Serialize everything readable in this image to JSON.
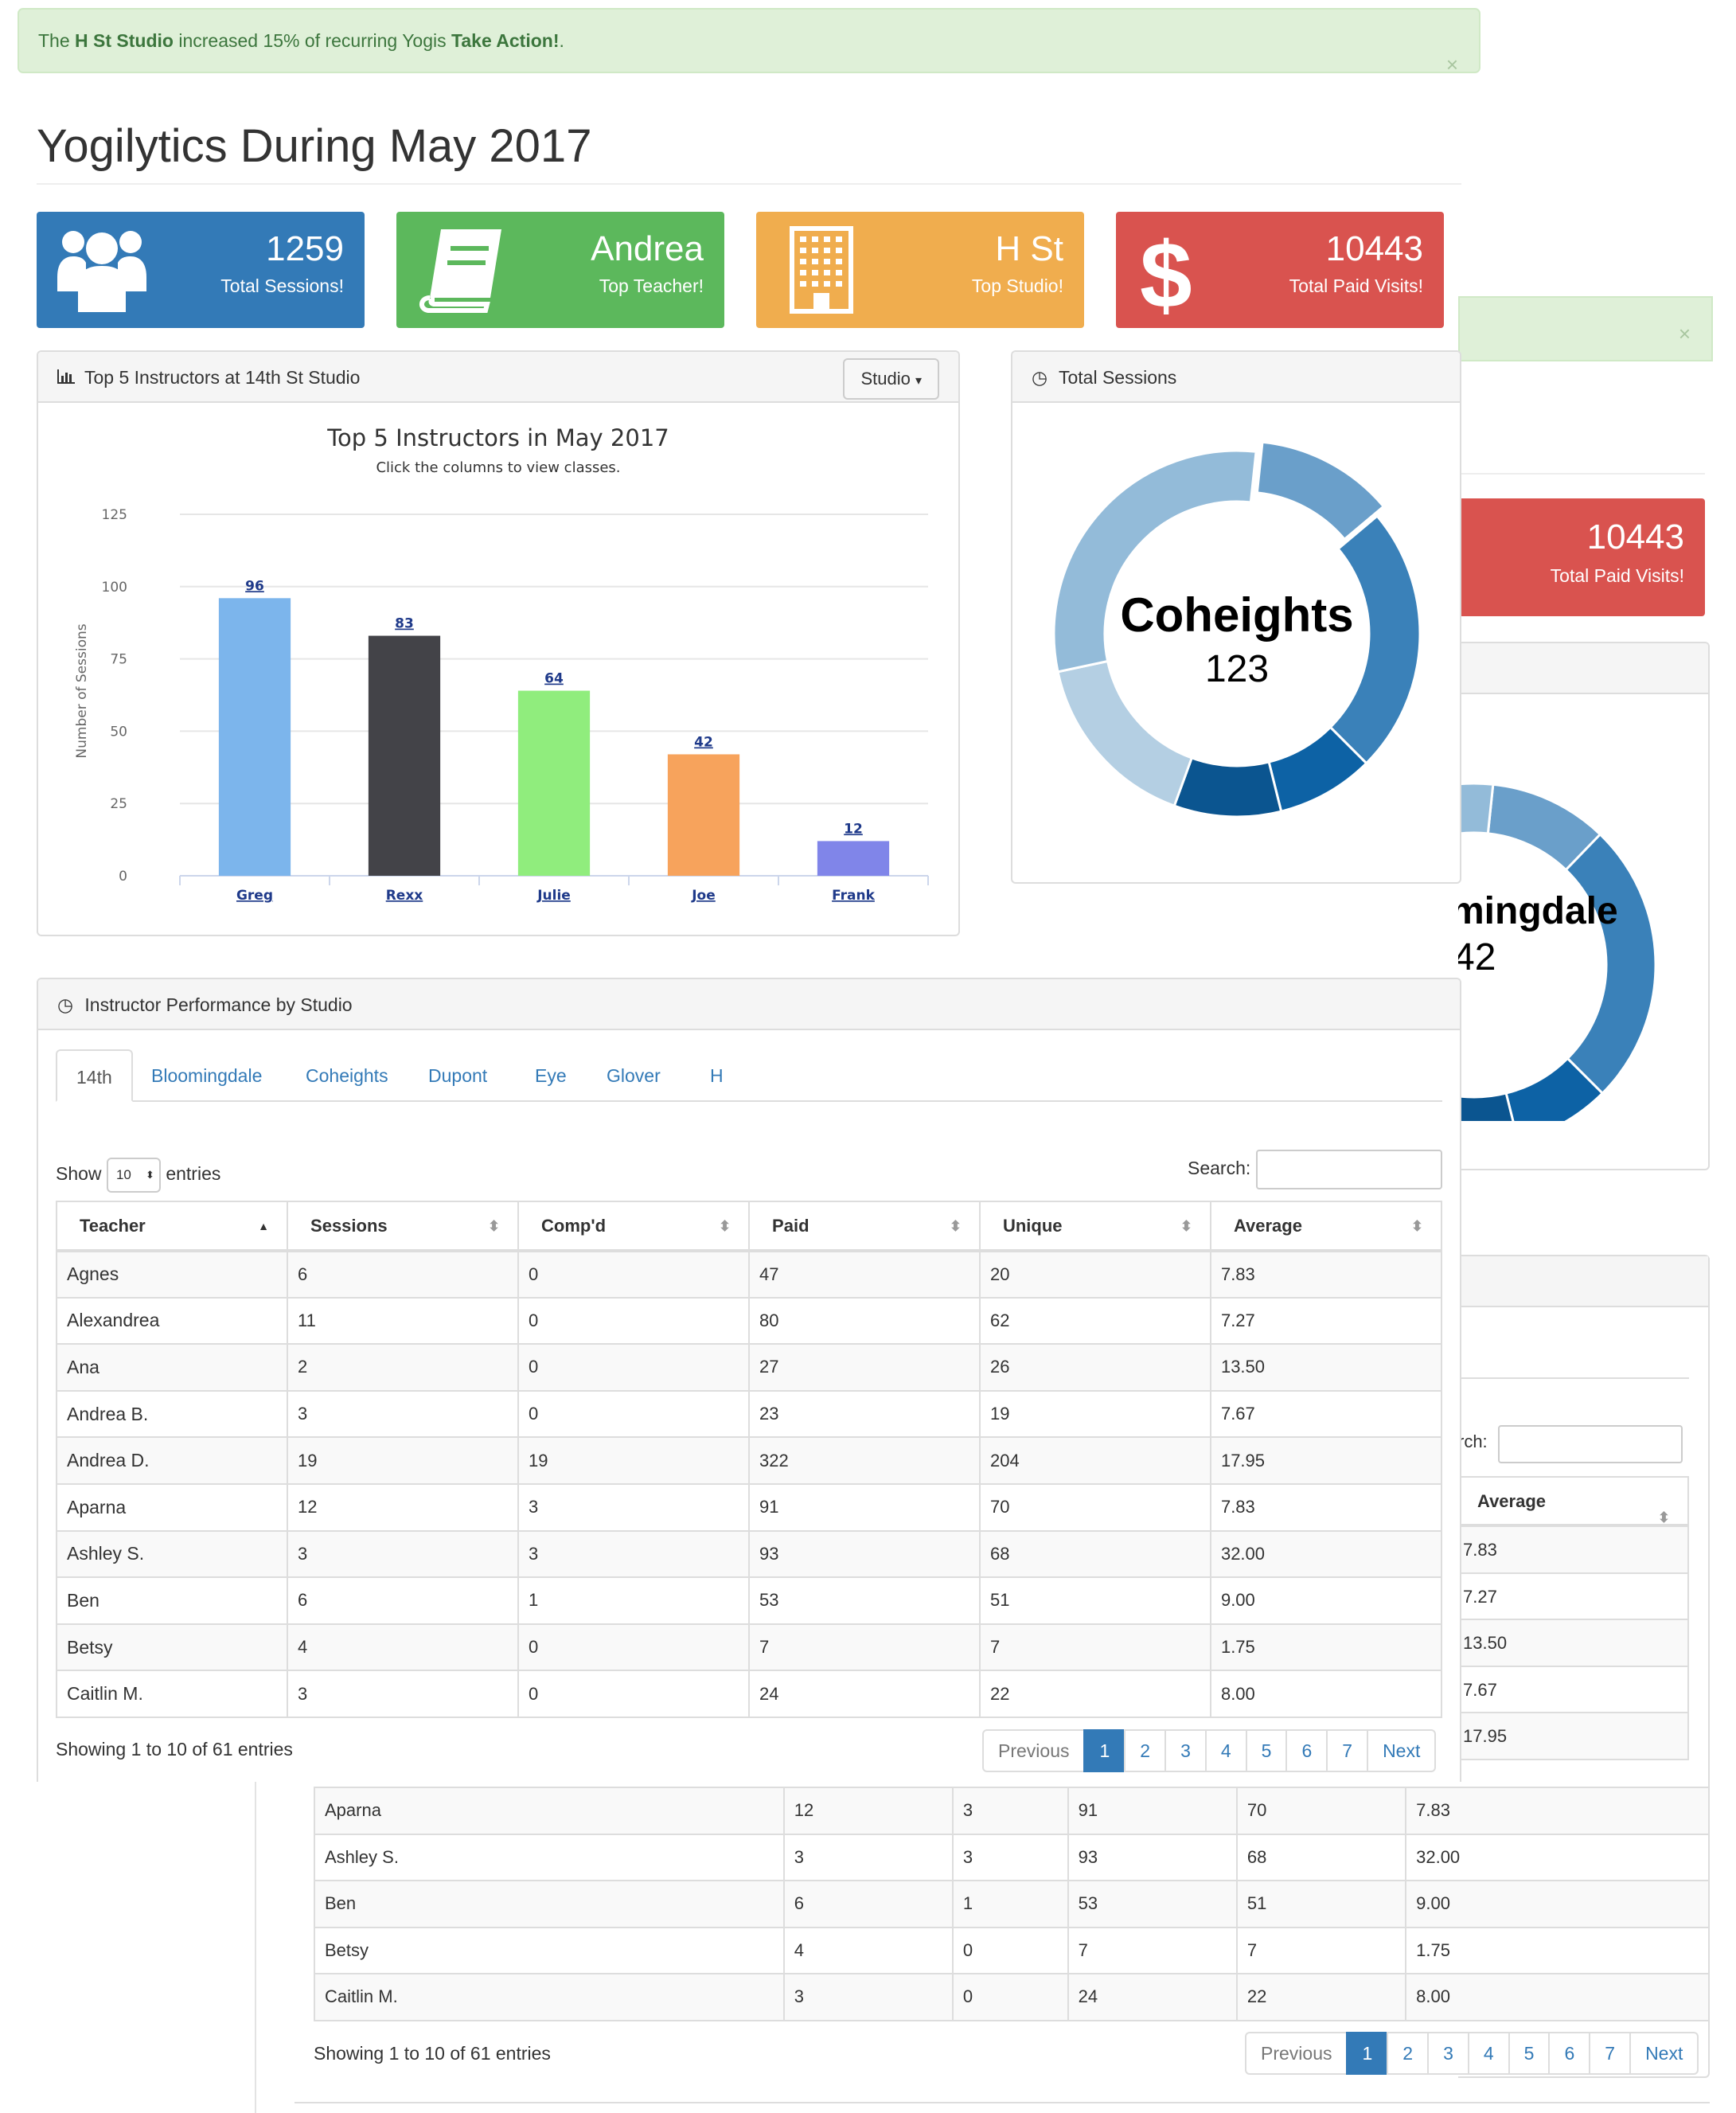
{
  "alert": {
    "text_pre": "The ",
    "studio": "H St Studio",
    "text_mid": " increased 15% of recurring Yogis ",
    "action": "Take Action!",
    "text_post": ".",
    "close": "×"
  },
  "page_title": "Yogilytics During May 2017",
  "tiles": [
    {
      "value": "1259",
      "label": "Total Sessions!",
      "icon": "users-icon",
      "color": "#337ab7"
    },
    {
      "value": "Andrea",
      "label": "Top Teacher!",
      "icon": "book-icon",
      "color": "#5cb85c"
    },
    {
      "value": "H St",
      "label": "Top Studio!",
      "icon": "building-icon",
      "color": "#f0ad4e"
    },
    {
      "value": "10443",
      "label": "Total Paid Visits!",
      "icon": "dollar-icon",
      "color": "#d9534f"
    }
  ],
  "top_panel": {
    "title": "Top 5 Instructors at 14th St Studio",
    "button": "Studio",
    "caret": "▾"
  },
  "chart_data": {
    "type": "bar",
    "title": "Top 5 Instructors in May 2017",
    "subtitle": "Click the columns to view classes.",
    "ylabel": "Number of Sessions",
    "xlabel": "",
    "categories": [
      "Greg",
      "Rexx",
      "Julie",
      "Joe",
      "Frank"
    ],
    "values": [
      96,
      83,
      64,
      42,
      12
    ],
    "colors": [
      "#7cb5ec",
      "#434348",
      "#90ed7d",
      "#f7a35c",
      "#8085e9"
    ],
    "ylim": [
      0,
      125
    ],
    "yticks": [
      "0",
      "25",
      "50",
      "75",
      "100",
      "125"
    ],
    "grid": true
  },
  "sessions_panel": {
    "title": "Total Sessions",
    "donut_name": "Coheights",
    "donut_value": "123"
  },
  "perf_panel": {
    "title": "Instructor Performance by Studio",
    "tabs": [
      "14th",
      "Bloomingdale",
      "Coheights",
      "Dupont",
      "Eye",
      "Glover",
      "H"
    ],
    "show_label": "Show",
    "entries_value": "10",
    "entries_label": "entries",
    "search_label": "Search:",
    "columns": [
      "Teacher",
      "Sessions",
      "Comp'd",
      "Paid",
      "Unique",
      "Average"
    ],
    "rows": [
      [
        "Agnes",
        "6",
        "0",
        "47",
        "20",
        "7.83"
      ],
      [
        "Alexandrea",
        "11",
        "0",
        "80",
        "62",
        "7.27"
      ],
      [
        "Ana",
        "2",
        "0",
        "27",
        "26",
        "13.50"
      ],
      [
        "Andrea B.",
        "3",
        "0",
        "23",
        "19",
        "7.67"
      ],
      [
        "Andrea D.",
        "19",
        "19",
        "322",
        "204",
        "17.95"
      ],
      [
        "Aparna",
        "12",
        "3",
        "91",
        "70",
        "7.83"
      ],
      [
        "Ashley S.",
        "3",
        "3",
        "93",
        "68",
        "32.00"
      ],
      [
        "Ben",
        "6",
        "1",
        "53",
        "51",
        "9.00"
      ],
      [
        "Betsy",
        "4",
        "0",
        "7",
        "7",
        "1.75"
      ],
      [
        "Caitlin M.",
        "3",
        "0",
        "24",
        "22",
        "8.00"
      ]
    ],
    "info": "Showing 1 to 10 of 61 entries",
    "pages": [
      "Previous",
      "1",
      "2",
      "3",
      "4",
      "5",
      "6",
      "7",
      "Next"
    ]
  },
  "bg": {
    "tile_value": "10443",
    "tile_label": "Total Paid Visits!",
    "donut_name": "mingdale",
    "donut_value": "42",
    "search_label": "rch:",
    "col_average": "Average",
    "averages": [
      "7.83",
      "7.27",
      "13.50",
      "7.67",
      "17.95"
    ],
    "rows": [
      [
        "Aparna",
        "12",
        "3",
        "91",
        "70",
        "7.83"
      ],
      [
        "Ashley S.",
        "3",
        "3",
        "93",
        "68",
        "32.00"
      ],
      [
        "Ben",
        "6",
        "1",
        "53",
        "51",
        "9.00"
      ],
      [
        "Betsy",
        "4",
        "0",
        "7",
        "7",
        "1.75"
      ],
      [
        "Caitlin M.",
        "3",
        "0",
        "24",
        "22",
        "8.00"
      ]
    ],
    "info": "Showing 1 to 10 of 61 entries",
    "pages": [
      "Previous",
      "1",
      "2",
      "3",
      "4",
      "5",
      "6",
      "7",
      "Next"
    ]
  }
}
